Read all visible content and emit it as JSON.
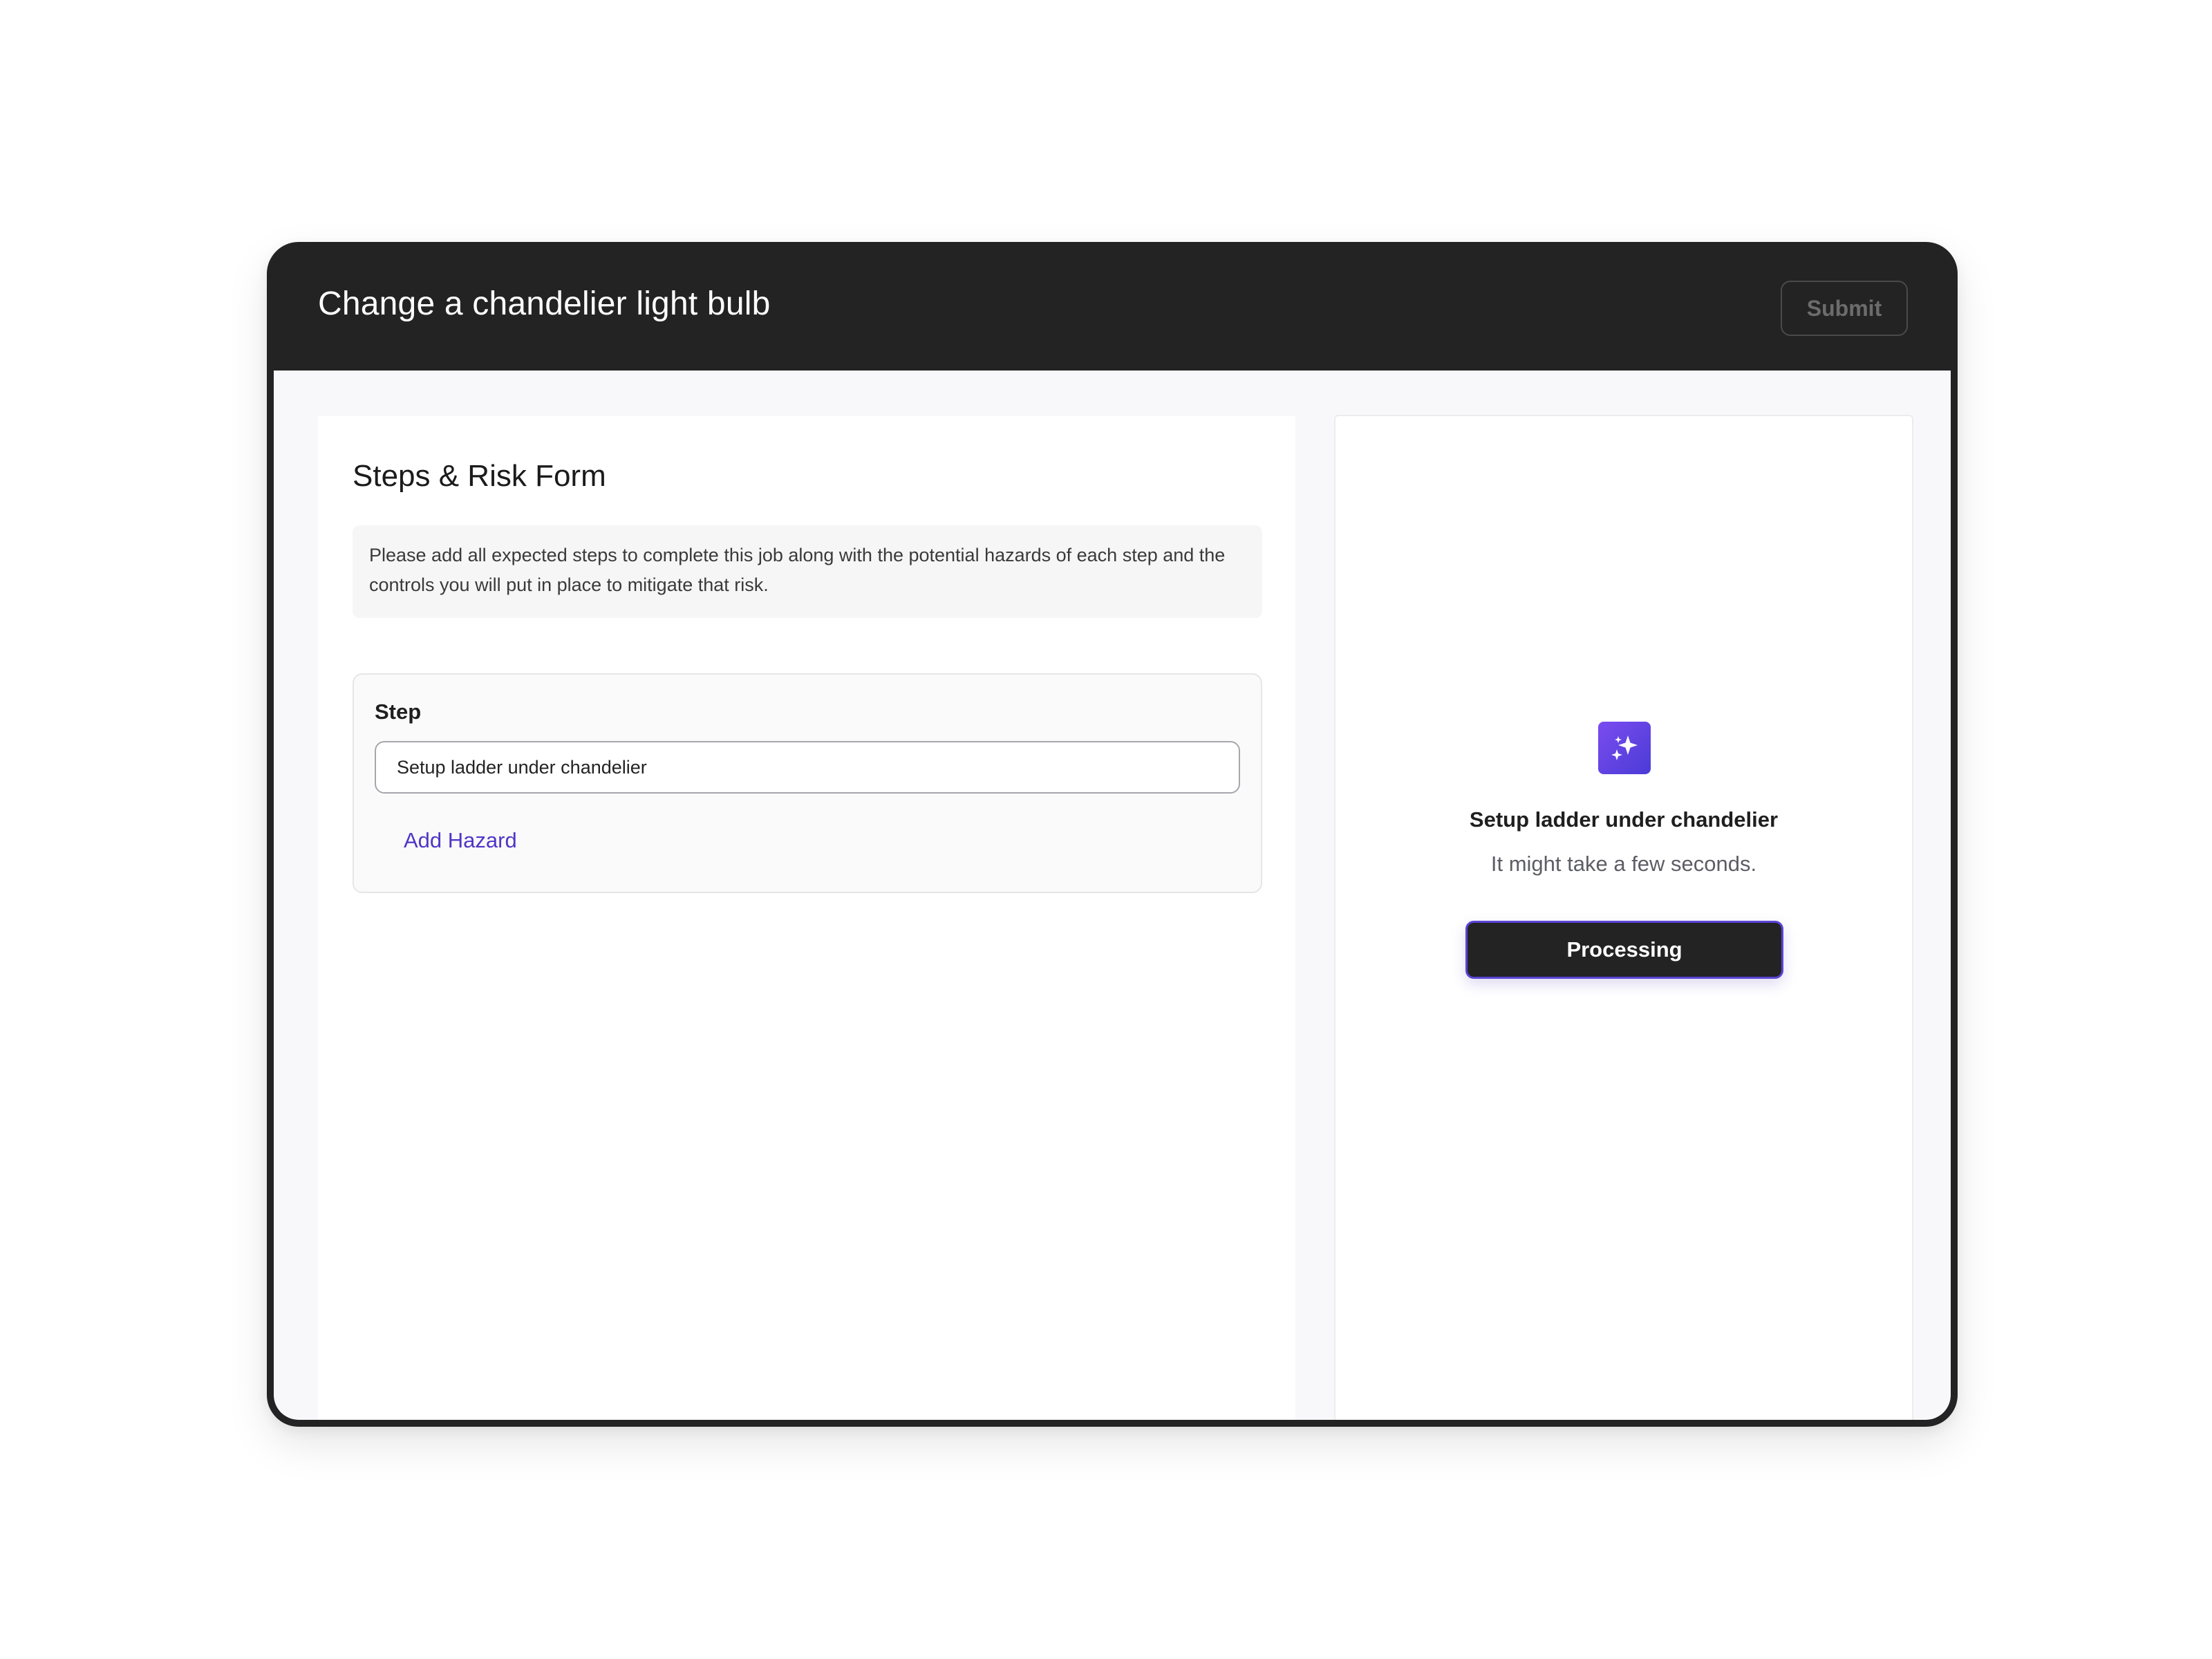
{
  "header": {
    "title": "Change a chandelier light bulb",
    "submit_label": "Submit"
  },
  "form": {
    "title": "Steps & Risk Form",
    "instructions": "Please add all expected steps to complete this job along with the potential hazards of each step and the controls you will put in place to mitigate that risk.",
    "step": {
      "label": "Step",
      "value": "Setup ladder under chandelier",
      "add_hazard_label": "Add Hazard"
    }
  },
  "processing": {
    "icon": "sparkles-icon",
    "title": "Setup ladder under chandelier",
    "subtitle": "It might take a few seconds.",
    "button_label": "Processing"
  },
  "colors": {
    "frame": "#232323",
    "accent": "#5036c7",
    "icon_gradient_start": "#7b4cf0",
    "icon_gradient_end": "#4b3bd6"
  }
}
